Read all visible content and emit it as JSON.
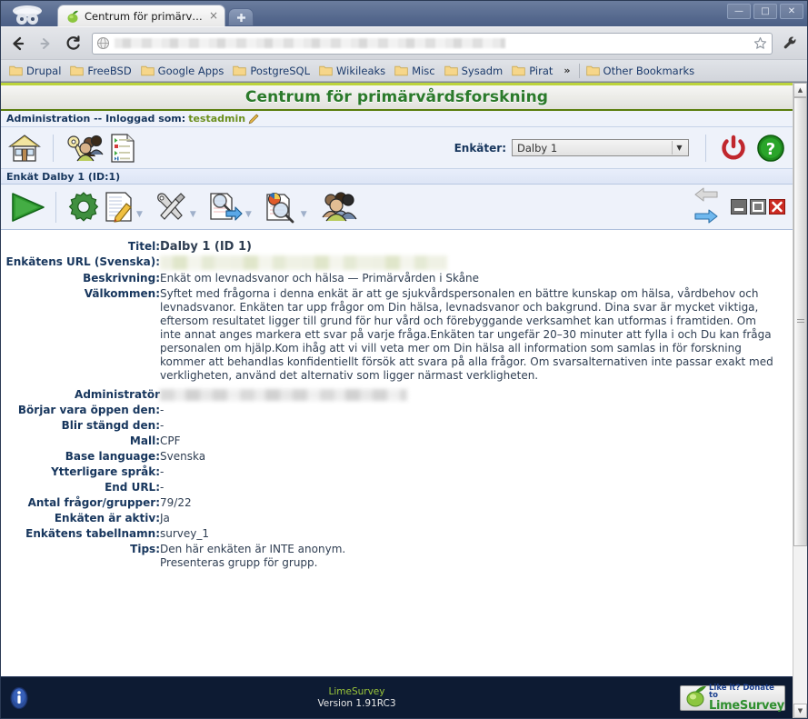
{
  "browser": {
    "tab": {
      "title": "Centrum för primärvå...",
      "favicon": "lime-icon",
      "close": "×"
    },
    "new_tab": "+",
    "window_controls": {
      "minimize": "—",
      "maximize": "□",
      "close": "✕"
    },
    "nav": {
      "back": "←",
      "forward": "→",
      "reload": "C"
    },
    "omnibox": {
      "value": "",
      "placeholder": "",
      "page_icon": "globe-icon",
      "star": "☆"
    },
    "menu": "wrench-icon",
    "bookmarks": [
      "Drupal",
      "FreeBSD",
      "Google Apps",
      "PostgreSQL",
      "Wikileaks",
      "Misc",
      "Sysadm",
      "Pirat"
    ],
    "bookmarks_overflow": "»",
    "other_bookmarks": "Other Bookmarks"
  },
  "app": {
    "header_title": "Centrum för primärvårdsforskning",
    "adminbar": {
      "text": "Administration -- Inloggad som:",
      "user": "testadmin",
      "edit_icon": "pencil-icon"
    },
    "toolbar_top": {
      "home": "home-icon",
      "users": "key-users-icon",
      "surveys_list": "survey-list-icon",
      "survey_label": "Enkäter:",
      "survey_selected": "Dalby 1",
      "select_arrow": "▼",
      "logout": "power-icon",
      "help": "help-icon"
    },
    "survey_bar_title": "Enkät Dalby 1 (ID:1)",
    "survey_toolbar": {
      "run": "play-icon",
      "general_settings": "gear-icon",
      "edit_survey": "edit-document-icon",
      "tools": "tools-icon",
      "export": "export-icon",
      "browse_responses": "responses-icon",
      "participants": "participants-icon",
      "prev": "left-arrow-icon",
      "next": "right-arrow-icon",
      "minimize": "minimize-icon",
      "restore": "restore-icon",
      "close": "close-icon"
    }
  },
  "details": {
    "rows": [
      {
        "label": "Titel:",
        "value": "Dalby 1 (ID 1)",
        "style": "title"
      },
      {
        "label": "Enkätens URL (Svenska):",
        "value": "",
        "style": "blur-url"
      },
      {
        "label": "Beskrivning:",
        "value": "Enkät om levnadsvanor och hälsa — Primärvården i Skåne",
        "style": "text"
      },
      {
        "label": "Välkommen:",
        "value": "Syftet med frågorna i denna enkät är att ge sjukvårdspersonalen en bättre kunskap om hälsa, vårdbehov och levnadsvanor. Enkäten tar upp frågor om Din hälsa, levnadsvanor och bakgrund. Dina svar är mycket viktiga, eftersom resultatet ligger till grund för hur vård och förebyggande verksamhet kan utformas i framtiden. Om inte annat anges markera ett svar på varje fråga.Enkäten tar ungefär 20–30 minuter att fylla i och Du kan fråga personalen om hjälp.Kom ihåg att vi vill veta mer om Din hälsa all information som samlas in för forskning kommer att behandlas konfidentiellt försök att svara på alla frågor. Om svarsalternativen inte passar exakt med verkligheten, använd det alternativ som ligger närmast verkligheten.",
        "style": "text"
      },
      {
        "label": "Administratör",
        "value": "",
        "style": "blur-admin"
      },
      {
        "label": "Börjar vara öppen den:",
        "value": "-",
        "style": "text"
      },
      {
        "label": "Blir stängd den:",
        "value": "-",
        "style": "text"
      },
      {
        "label": "Mall:",
        "value": "CPF",
        "style": "text"
      },
      {
        "label": "Base language:",
        "value": "Svenska",
        "style": "text"
      },
      {
        "label": "Ytterligare språk:",
        "value": "-",
        "style": "text"
      },
      {
        "label": "End URL:",
        "value": "-",
        "style": "text"
      },
      {
        "label": "Antal frågor/grupper:",
        "value": "79/22",
        "style": "text"
      },
      {
        "label": "Enkäten är aktiv:",
        "value": "Ja",
        "style": "text"
      },
      {
        "label": "Enkätens tabellnamn:",
        "value": "survey_1",
        "style": "text"
      },
      {
        "label": "Tips:",
        "value": "Den här enkäten är INTE anonym.\nPresenteras grupp för grupp.",
        "style": "text"
      }
    ]
  },
  "footer": {
    "info_icon": "info-icon",
    "brand": "LimeSurvey",
    "version": "Version 1.91RC3",
    "donate": {
      "line1": "Like it? Donate to",
      "line2": "LimeSurvey",
      "icon": "lime-icon"
    }
  },
  "scrollbar": {
    "up": "▲",
    "down": "▼"
  },
  "colors": {
    "header_green": "#2b7a2b",
    "accent_lime": "#bcd43a",
    "label_navy": "#17365d",
    "user_olive": "#6b8f1e",
    "footer_bg": "#0d1b33"
  }
}
